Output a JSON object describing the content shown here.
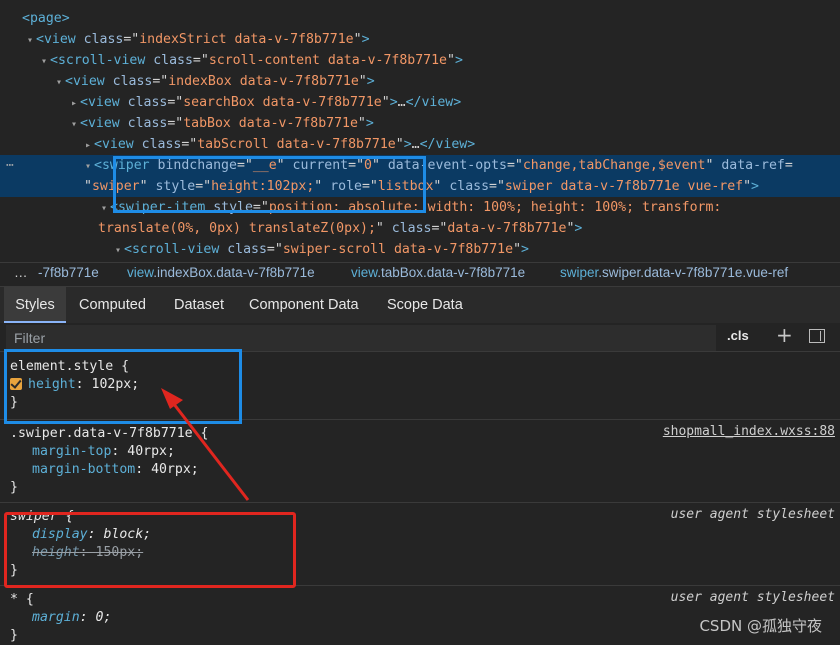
{
  "dom_tree": {
    "lines": [
      {
        "indent": 22,
        "tri": "",
        "open": "<page>",
        "rest": []
      },
      {
        "indent": 24,
        "tri": "▾",
        "parts": [
          [
            "tag",
            "<view "
          ],
          [
            "attr",
            "class"
          ],
          [
            "plain",
            "=\""
          ],
          [
            "val",
            "indexStrict data-v-7f8b771e"
          ],
          [
            "plain",
            "\""
          ],
          [
            "tag",
            ">"
          ]
        ]
      },
      {
        "indent": 38,
        "tri": "▾",
        "parts": [
          [
            "tag",
            "<scroll-view "
          ],
          [
            "attr",
            "class"
          ],
          [
            "plain",
            "=\""
          ],
          [
            "val",
            "scroll-content data-v-7f8b771e"
          ],
          [
            "plain",
            "\""
          ],
          [
            "tag",
            ">"
          ]
        ]
      },
      {
        "indent": 53,
        "tri": "▾",
        "parts": [
          [
            "tag",
            "<view "
          ],
          [
            "attr",
            "class"
          ],
          [
            "plain",
            "=\""
          ],
          [
            "val",
            "indexBox data-v-7f8b771e"
          ],
          [
            "plain",
            "\""
          ],
          [
            "tag",
            ">"
          ]
        ]
      },
      {
        "indent": 68,
        "tri": "▸",
        "parts": [
          [
            "tag",
            "<view "
          ],
          [
            "attr",
            "class"
          ],
          [
            "plain",
            "=\""
          ],
          [
            "val",
            "searchBox data-v-7f8b771e"
          ],
          [
            "plain",
            "\""
          ],
          [
            "tag",
            ">"
          ],
          [
            "txt",
            "…"
          ],
          [
            "tag",
            "</view>"
          ]
        ]
      },
      {
        "indent": 68,
        "tri": "▾",
        "parts": [
          [
            "tag",
            "<view "
          ],
          [
            "attr",
            "class"
          ],
          [
            "plain",
            "=\""
          ],
          [
            "val",
            "tabBox data-v-7f8b771e"
          ],
          [
            "plain",
            "\""
          ],
          [
            "tag",
            ">"
          ]
        ]
      },
      {
        "indent": 82,
        "tri": "▸",
        "parts": [
          [
            "tag",
            "<view "
          ],
          [
            "attr",
            "class"
          ],
          [
            "plain",
            "=\""
          ],
          [
            "val",
            "tabScroll data-v-7f8b771e"
          ],
          [
            "plain",
            "\""
          ],
          [
            "tag",
            ">"
          ],
          [
            "txt",
            "…"
          ],
          [
            "tag",
            "</view>"
          ]
        ]
      },
      {
        "indent": 82,
        "tri": "▾",
        "selected": true,
        "parts": [
          [
            "tag",
            "<swiper "
          ],
          [
            "attr",
            "bindchange"
          ],
          [
            "plain",
            "=\""
          ],
          [
            "val",
            "__e"
          ],
          [
            "plain",
            "\" "
          ],
          [
            "attr",
            "current"
          ],
          [
            "plain",
            "=\""
          ],
          [
            "val",
            "0"
          ],
          [
            "plain",
            "\" "
          ],
          [
            "attr",
            "data-event-opts"
          ],
          [
            "plain",
            "=\""
          ],
          [
            "val",
            "change,tabChange,$event"
          ],
          [
            "plain",
            "\" "
          ],
          [
            "attr",
            "data-ref"
          ],
          [
            "plain",
            "="
          ]
        ]
      },
      {
        "indent": 84,
        "tri": "",
        "selected": true,
        "parts": [
          [
            "plain",
            "\""
          ],
          [
            "val",
            "swiper"
          ],
          [
            "plain",
            "\" "
          ],
          [
            "attr",
            "style"
          ],
          [
            "plain",
            "=\""
          ],
          [
            "val",
            "height:102px;"
          ],
          [
            "plain",
            "\" "
          ],
          [
            "attr",
            "role"
          ],
          [
            "plain",
            "=\""
          ],
          [
            "val",
            "listbox"
          ],
          [
            "plain",
            "\" "
          ],
          [
            "attr",
            "class"
          ],
          [
            "plain",
            "=\""
          ],
          [
            "val",
            "swiper data-v-7f8b771e vue-ref"
          ],
          [
            "plain",
            "\""
          ],
          [
            "tag",
            ">"
          ]
        ]
      },
      {
        "indent": 98,
        "tri": "▾",
        "parts": [
          [
            "tag",
            "<swiper-item "
          ],
          [
            "attr",
            "style"
          ],
          [
            "plain",
            "=\""
          ],
          [
            "val",
            "position: absolute; width: 100%; height: 100%; transform:"
          ]
        ]
      },
      {
        "indent": 98,
        "tri": "",
        "parts": [
          [
            "val",
            "translate(0%, 0px) translateZ(0px);"
          ],
          [
            "plain",
            "\" "
          ],
          [
            "attr",
            "class"
          ],
          [
            "plain",
            "=\""
          ],
          [
            "val",
            "data-v-7f8b771e"
          ],
          [
            "plain",
            "\""
          ],
          [
            "tag",
            ">"
          ]
        ]
      },
      {
        "indent": 112,
        "tri": "▾",
        "parts": [
          [
            "tag",
            "<scroll-view "
          ],
          [
            "attr",
            "class"
          ],
          [
            "plain",
            "=\""
          ],
          [
            "val",
            "swiper-scroll data-v-7f8b771e"
          ],
          [
            "plain",
            "\""
          ],
          [
            "tag",
            ">"
          ]
        ]
      }
    ]
  },
  "breadcrumb": {
    "more": "…",
    "items": [
      {
        "tag": "",
        "rest": "-7f8b771e"
      },
      {
        "tag": "view",
        "rest": ".indexBox.data-v-7f8b771e"
      },
      {
        "tag": "view",
        "rest": ".tabBox.data-v-7f8b771e"
      },
      {
        "tag": "swiper",
        "rest": ".swiper.data-v-7f8b771e.vue-ref"
      }
    ]
  },
  "tabs": [
    "Styles",
    "Computed",
    "Dataset",
    "Component Data",
    "Scope Data"
  ],
  "filter": {
    "placeholder": "Filter",
    "cls_label": ".cls",
    "add_label": "+"
  },
  "rules": [
    {
      "selector": "element.style {",
      "source": "",
      "decls": [
        {
          "prop": "height",
          "value": "102px;",
          "checked": true
        }
      ],
      "close": "}"
    },
    {
      "selector": ".swiper.data-v-7f8b771e {",
      "source": "shopmall_index.wxss:88",
      "decls": [
        {
          "prop": "margin-top",
          "value": "40rpx;"
        },
        {
          "prop": "margin-bottom",
          "value": "40rpx;"
        }
      ],
      "close": "}"
    },
    {
      "selector": "swiper {",
      "source": "user agent stylesheet",
      "decls": [
        {
          "prop": "display",
          "value": "block;"
        },
        {
          "prop": "height",
          "value": "150px;",
          "overridden": true
        }
      ],
      "close": "}"
    },
    {
      "selector": "* {",
      "source": "user agent stylesheet",
      "decls": [
        {
          "prop": "margin",
          "value": "0;"
        }
      ],
      "close": "}"
    }
  ],
  "annotation_colors": {
    "blue": "#1e8ce6",
    "red": "#e0261f"
  },
  "watermark": "CSDN @孤独守夜"
}
